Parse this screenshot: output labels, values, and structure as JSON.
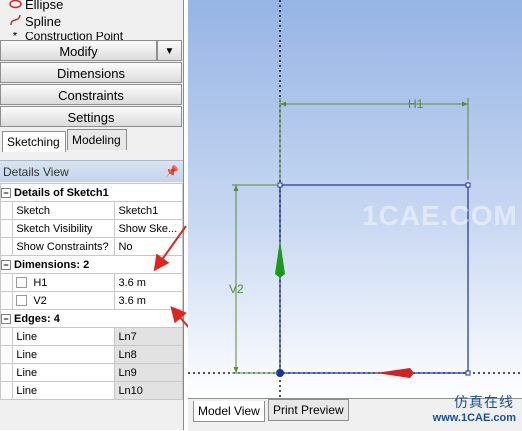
{
  "toolbox": {
    "items": [
      {
        "label": "Ellipse",
        "icon": "ellipse-icon"
      },
      {
        "label": "Spline",
        "icon": "spline-icon"
      },
      {
        "label": "Construction Point",
        "icon": "construction-point-icon"
      }
    ],
    "groups": [
      "Modify",
      "Dimensions",
      "Constraints",
      "Settings"
    ]
  },
  "mode_tabs": [
    "Sketching",
    "Modeling"
  ],
  "details": {
    "title": "Details View",
    "sketch_section": "Details of Sketch1",
    "sketch_rows": [
      {
        "label": "Sketch",
        "value": "Sketch1"
      },
      {
        "label": "Sketch Visibility",
        "value": "Show Ske..."
      },
      {
        "label": "Show Constraints?",
        "value": "No"
      }
    ],
    "dimensions_section": "Dimensions: 2",
    "dimension_rows": [
      {
        "label": "H1",
        "value": "3.6 m"
      },
      {
        "label": "V2",
        "value": "3.6 m"
      }
    ],
    "edges_section": "Edges: 4",
    "edge_rows": [
      {
        "label": "Line",
        "value": "Ln7"
      },
      {
        "label": "Line",
        "value": "Ln8"
      },
      {
        "label": "Line",
        "value": "Ln9"
      },
      {
        "label": "Line",
        "value": "Ln10"
      }
    ]
  },
  "viewport": {
    "dim_h_label": "H1",
    "dim_v_label": "V2",
    "watermark_center": "1CAE.COM"
  },
  "view_tabs": [
    "Model View",
    "Print Preview"
  ],
  "watermark": {
    "cn": "仿真在线",
    "url": "www.1CAE.com"
  },
  "colors": {
    "sketch_line": "#1f2f9c",
    "dimension_line": "#5a8a3a",
    "annotation_arrow": "#e0251f",
    "axis_x": "#d42020",
    "axis_y": "#1a9a1a"
  }
}
